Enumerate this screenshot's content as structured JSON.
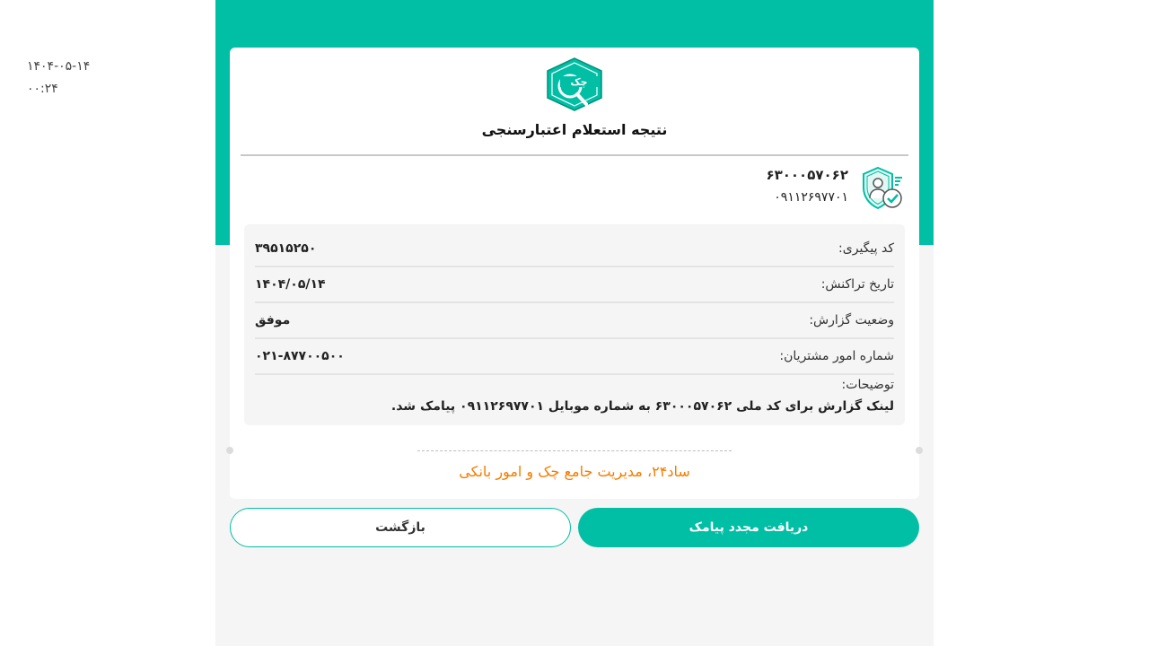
{
  "stamp": {
    "date": "۱۴۰۴-۰۵-۱۴",
    "time": "۰۰:۲۴"
  },
  "colors": {
    "brand": "#00bfa5",
    "accent": "#f57c00",
    "panel": "#f5f5f5"
  },
  "card": {
    "logo_text": "چک",
    "title": "نتیجه استعلام اعتبارسنجی",
    "user": {
      "national_id": "۶۳۰۰۰۵۷۰۶۲",
      "mobile": "۰۹۱۱۲۶۹۷۷۰۱",
      "icon": "verified-user-shield-icon"
    },
    "rows": [
      {
        "label": "کد پیگیری:",
        "value": "۳۹۵۱۵۲۵۰"
      },
      {
        "label": "تاریخ تراکنش:",
        "value": "۱۴۰۴/۰۵/۱۴"
      },
      {
        "label": "وضعیت گزارش:",
        "value": "موفق"
      },
      {
        "label": "شماره امور مشتریان:",
        "value": "۰۲۱-۸۷۷۰۰۵۰۰"
      }
    ],
    "description_label": "توضیحات:",
    "description": "لینک گزارش برای کد ملی ۶۳۰۰۰۵۷۰۶۲ به شماره موبایل ۰۹۱۱۲۶۹۷۷۰۱ پیامک شد.",
    "footer_note": "ساد۲۴، مدیریت جامع چک و امور بانکی"
  },
  "buttons": {
    "resend": "دریافت مجدد پیامک",
    "back": "بازگشت"
  }
}
